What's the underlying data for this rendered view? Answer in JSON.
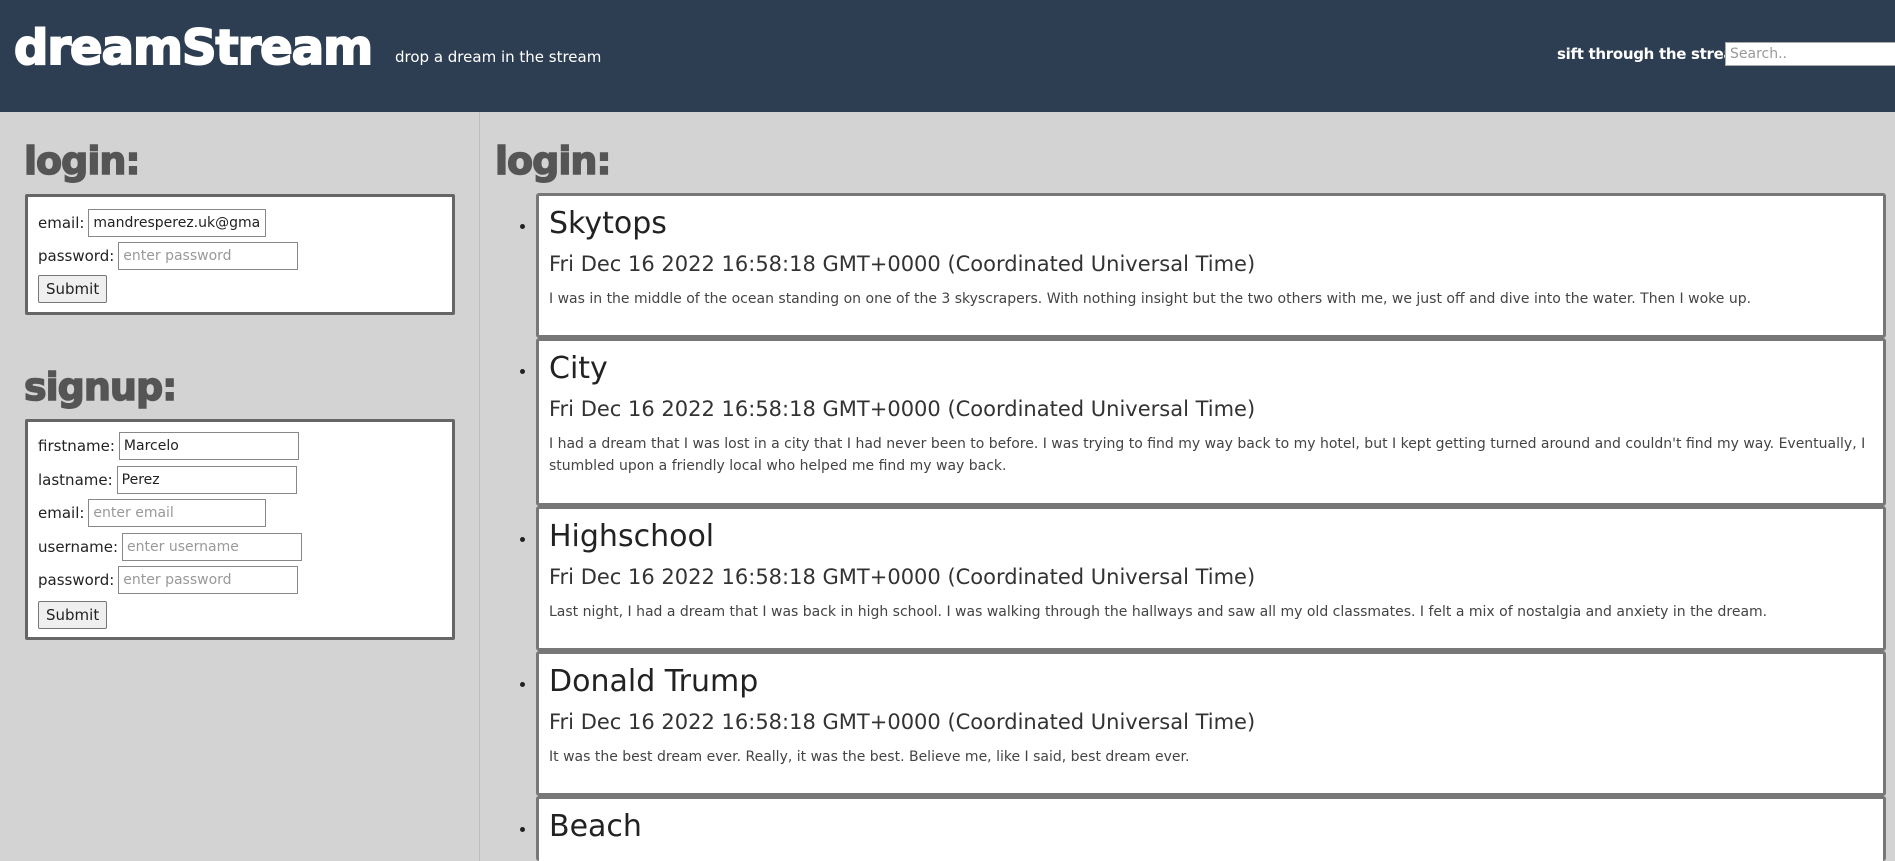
{
  "header": {
    "logo": "dreamStream",
    "tagline": "drop a dream in the stream",
    "search_label": "sift through the stream:",
    "search_placeholder": "Search.."
  },
  "login_form": {
    "heading": "login:",
    "email_label": "email:",
    "email_value": "mandresperez.uk@gmail.com",
    "password_label": "password:",
    "password_placeholder": "enter password",
    "submit_label": "Submit"
  },
  "signup_form": {
    "heading": "signup:",
    "firstname_label": "firstname:",
    "firstname_value": "Marcelo",
    "lastname_label": "lastname:",
    "lastname_value": "Perez",
    "email_label": "email:",
    "email_placeholder": "enter email",
    "username_label": "username:",
    "username_placeholder": "enter username",
    "password_label": "password:",
    "password_placeholder": "enter password",
    "submit_label": "Submit"
  },
  "stream": {
    "heading": "login:",
    "dreams": [
      {
        "title": "Skytops",
        "date": "Fri Dec 16 2022 16:58:18 GMT+0000 (Coordinated Universal Time)",
        "body": "I was in the middle of the ocean standing on one of the 3 skyscrapers. With nothing insight but the two others with me, we just off and dive into the water. Then I woke up."
      },
      {
        "title": "City",
        "date": "Fri Dec 16 2022 16:58:18 GMT+0000 (Coordinated Universal Time)",
        "body": "I had a dream that I was lost in a city that I had never been to before. I was trying to find my way back to my hotel, but I kept getting turned around and couldn't find my way. Eventually, I stumbled upon a friendly local who helped me find my way back."
      },
      {
        "title": "Highschool",
        "date": "Fri Dec 16 2022 16:58:18 GMT+0000 (Coordinated Universal Time)",
        "body": "Last night, I had a dream that I was back in high school. I was walking through the hallways and saw all my old classmates. I felt a mix of nostalgia and anxiety in the dream."
      },
      {
        "title": "Donald Trump",
        "date": "Fri Dec 16 2022 16:58:18 GMT+0000 (Coordinated Universal Time)",
        "body": "It was the best dream ever. Really, it was the best. Believe me, like I said, best dream ever."
      },
      {
        "title": "Beach",
        "date": "",
        "body": ""
      }
    ]
  }
}
